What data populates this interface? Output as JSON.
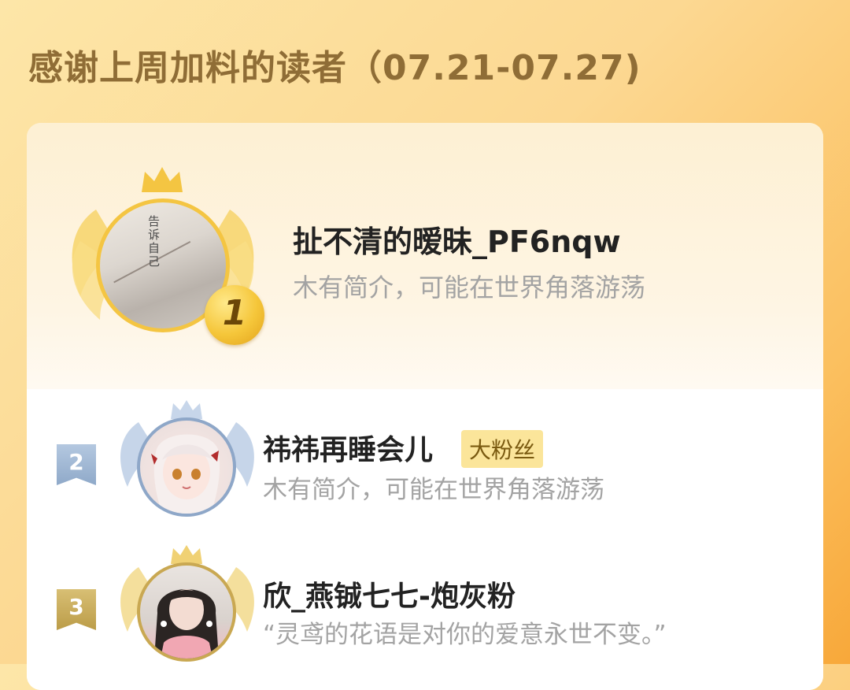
{
  "header": {
    "title": "感谢上周加料的读者（07.21-07.27)"
  },
  "readers": [
    {
      "rank": "1",
      "name": "扯不清的暧昧_PF6nqw",
      "bio": "木有简介，可能在世界角落游荡",
      "avatar_text": "告诉自己"
    },
    {
      "rank": "2",
      "name": "祎祎再睡会儿",
      "badge": "大粉丝",
      "bio": "木有简介，可能在世界角落游荡"
    },
    {
      "rank": "3",
      "name": "欣_燕铖七七-炮灰粉",
      "bio": "“灵鸢的花语是对你的爱意永世不变。”"
    }
  ],
  "colors": {
    "gold": "#f4c542",
    "silver": "#8ea7c8",
    "bronze": "#c9a852",
    "title": "#8f6d36"
  }
}
